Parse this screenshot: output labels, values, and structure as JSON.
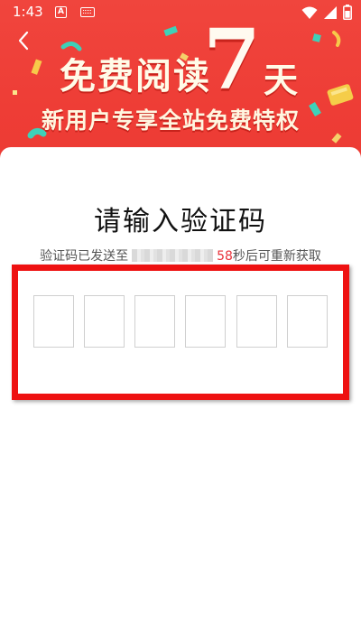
{
  "status_bar": {
    "time": "1:43",
    "icons": [
      "notification-a-icon",
      "keyboard-icon",
      "wifi-icon",
      "signal-icon",
      "battery-icon"
    ]
  },
  "banner": {
    "title": "免费阅读",
    "number": "7",
    "unit": "天",
    "subtitle": "新用户专享全站免费特权",
    "background_color": "#ef4139"
  },
  "verify": {
    "title": "请输入验证码",
    "sent_prefix": "验证码已发送至",
    "countdown_number": "58",
    "countdown_suffix": "秒后可重新获取",
    "code_boxes": [
      "",
      "",
      "",
      "",
      "",
      ""
    ],
    "accent_color": "#e8323a"
  }
}
